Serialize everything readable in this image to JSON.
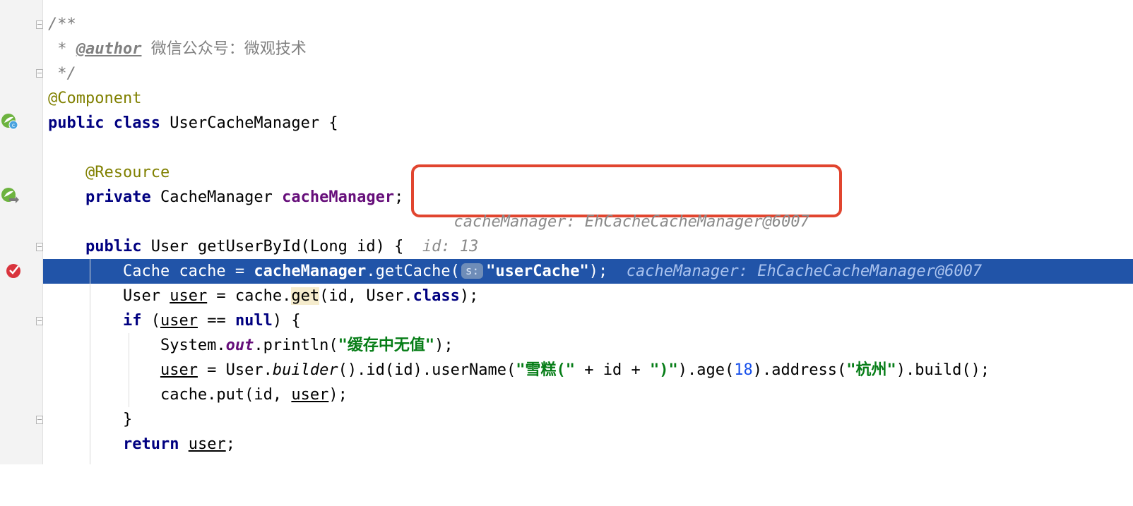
{
  "editor": {
    "doc_open": "/**",
    "doc_star": " * ",
    "author_tag": "@author",
    "author_value": " 微信公众号：微观技术",
    "doc_close": " */",
    "annotation_component": "@Component",
    "kw_public": "public",
    "kw_class": "class",
    "class_name": " UserCacheManager {",
    "annotation_resource": "@Resource",
    "kw_private": "private",
    "field_type": " CacheManager ",
    "field_name": "cacheManager",
    "semicolon": ";",
    "method_sig": " User getUserById(Long id) {",
    "method_hint": "id: 13",
    "cur_decl": "Cache cache = ",
    "cur_field": "cacheManager",
    "cur_call": ".getCache(",
    "cur_param_hint": "s:",
    "cur_arg": "\"userCache\"",
    "cur_end": ");",
    "cur_hint": "cacheManager: EhCacheCacheManager@6007",
    "l11_a": "User ",
    "l11_user": "user",
    "l11_b": " = cache.",
    "l11_get": "get",
    "l11_c": "(id, User.",
    "l11_class": "class",
    "l11_d": ");",
    "kw_if": "if",
    "l12_a": " (",
    "l12_user": "user",
    "l12_b": " == ",
    "kw_null": "null",
    "l12_c": ") {",
    "l13_a": "System.",
    "l13_out": "out",
    "l13_b": ".println(",
    "l13_str": "\"缓存中无值\"",
    "l13_c": ");",
    "l14_user": "user",
    "l14_a": " = User.",
    "l14_builder": "builder",
    "l14_b": "().id(id).userName(",
    "l14_str1": "\"雪糕(\"",
    "l14_c": " + id + ",
    "l14_str2": "\")\"",
    "l14_d": ").age(",
    "l14_num": "18",
    "l14_e": ").address(",
    "l14_str3": "\"杭州\"",
    "l14_f": ").build();",
    "l15_a": "cache.put(id, ",
    "l15_user": "user",
    "l15_b": ");",
    "l16": "}",
    "kw_return": "return",
    "l17_user": "user",
    "l17_b": ";"
  },
  "callout": {
    "text": "cacheManager: EhCacheCacheManager@6007"
  },
  "colors": {
    "current_line": "#2154a8",
    "callout_border": "#e1452f",
    "keyword": "#000080",
    "string": "#067d17",
    "annotation": "#808000",
    "field": "#660e7a"
  },
  "icons": [
    "spring-bean-class-icon",
    "spring-bean-inject-icon",
    "breakpoint-icon",
    "fold-marker-icon"
  ]
}
